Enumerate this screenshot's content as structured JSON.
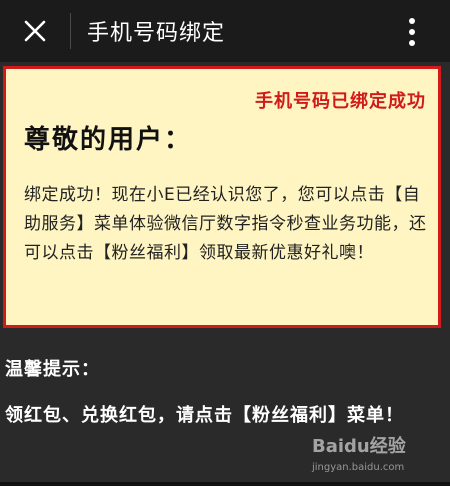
{
  "topbar": {
    "title": "手机号码绑定",
    "close_icon": "close-icon",
    "more_icon": "more-vertical-icon"
  },
  "card": {
    "status": "手机号码已绑定成功",
    "greeting": "尊敬的用户：",
    "message": "绑定成功！现在小E已经认识您了，您可以点击【自助服务】菜单体验微信厅数字指令秒查业务功能，还可以点击【粉丝福利】领取最新优惠好礼噢！",
    "accent_color": "#d11b1b",
    "background_color": "#fff5c2"
  },
  "tips": {
    "title": "温馨提示：",
    "body": "领红包、兑换红包，请点击【粉丝福利】菜单！"
  },
  "watermark": {
    "brand": "Baidu经验",
    "url": "jingyan.baidu.com"
  }
}
